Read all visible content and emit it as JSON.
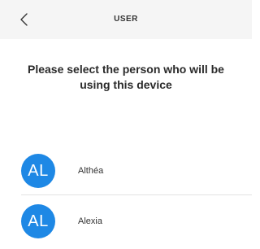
{
  "header": {
    "back_icon": "chevron-left-icon",
    "title": "USER"
  },
  "prompt": {
    "text": "Please select the person who will be using this device"
  },
  "users": [
    {
      "initials": "AL",
      "name": "Althéa"
    },
    {
      "initials": "AL",
      "name": "Alexia"
    }
  ],
  "colors": {
    "header_bg": "#f5f5f5",
    "avatar_bg": "#1e88e5",
    "divider": "#e2e2e2"
  }
}
